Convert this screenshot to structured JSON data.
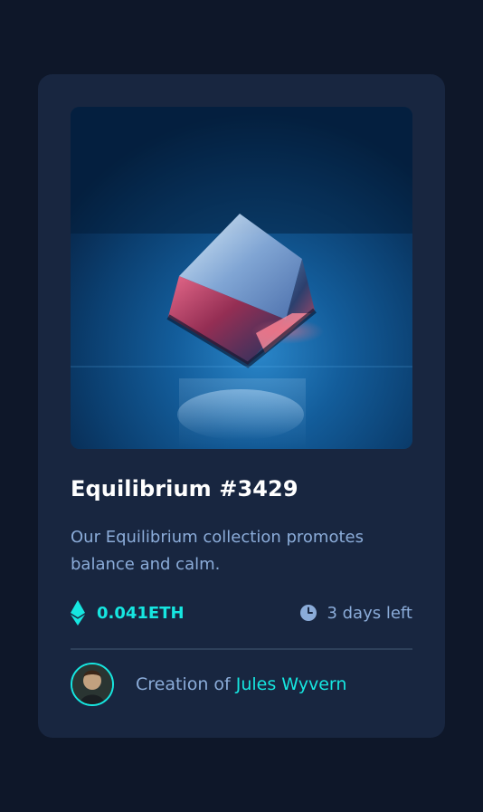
{
  "card": {
    "title": "Equilibrium #3429",
    "description": "Our Equilibrium collection promotes balance and calm.",
    "price": "0.041ETH",
    "time_left": "3 days left",
    "creator_prefix": "Creation of",
    "creator_name": "Jules Wyvern"
  },
  "icons": {
    "price": "ethereum-icon",
    "time": "clock-icon"
  },
  "colors": {
    "page_bg": "#0e1729",
    "card_bg": "#182640",
    "accent_cyan": "#16e6e0",
    "soft_blue": "#8bacd9",
    "white": "#ffffff",
    "divider": "#2e405a"
  }
}
